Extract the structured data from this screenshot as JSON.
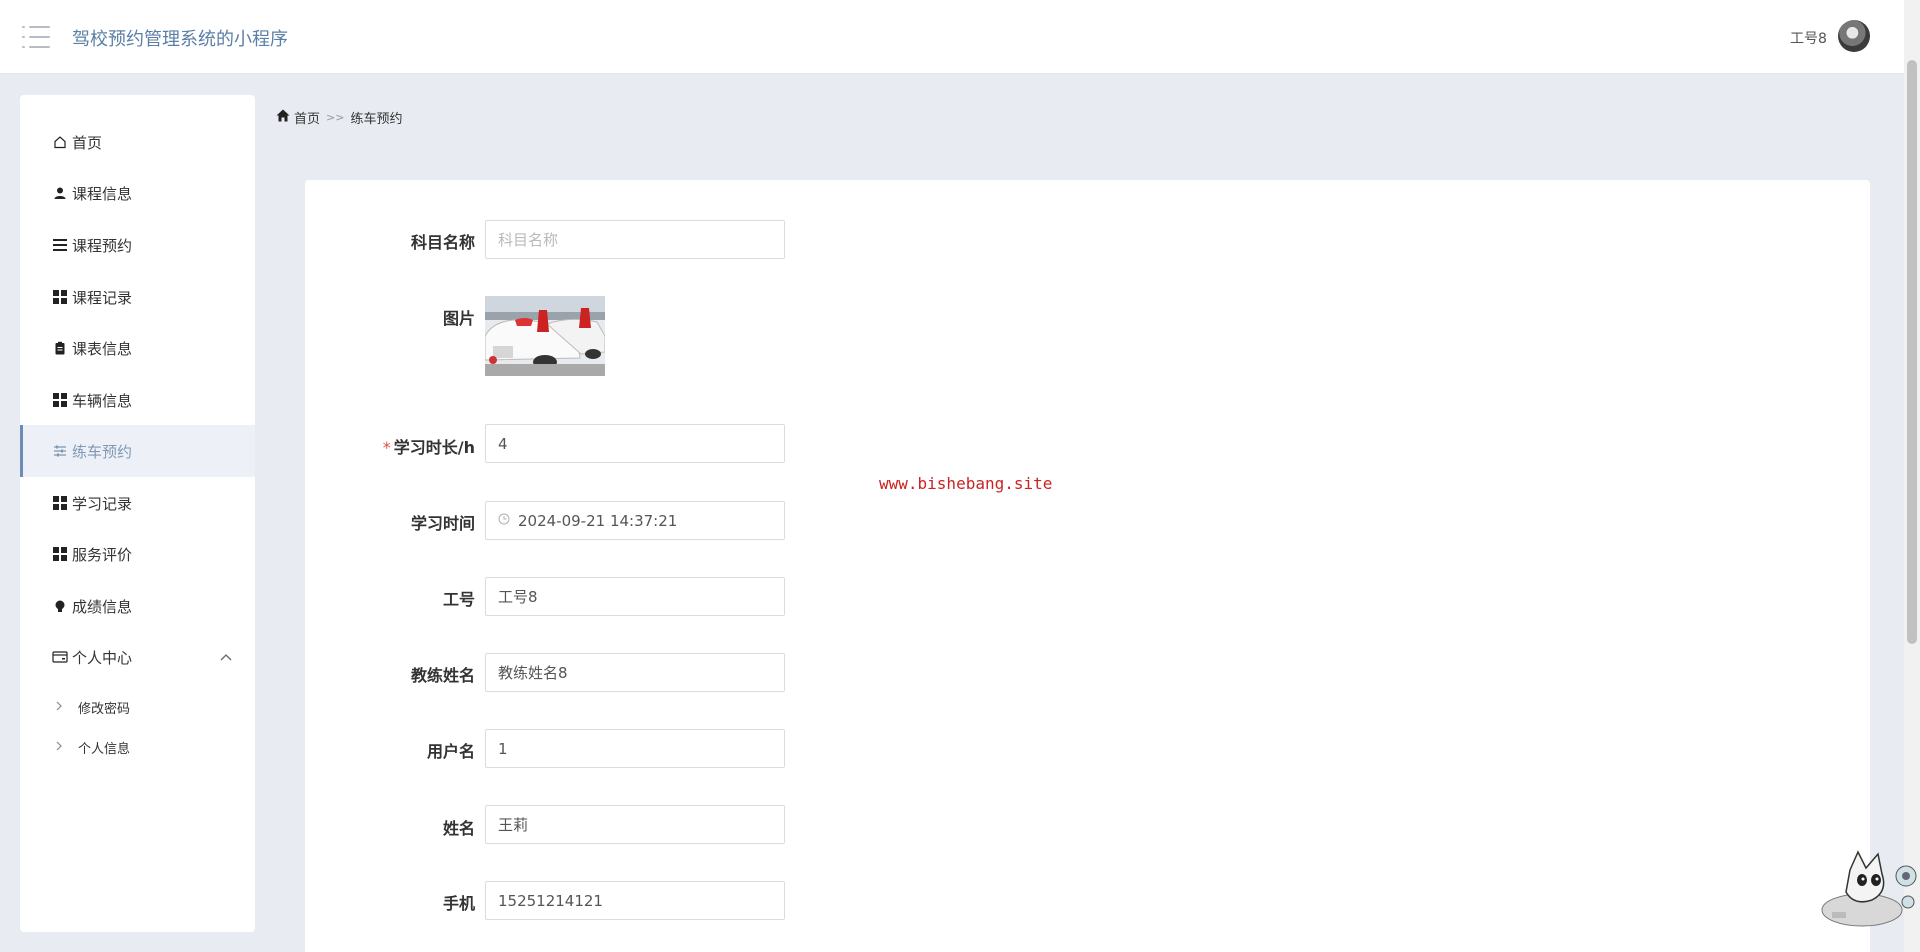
{
  "header": {
    "app_title": "驾校预约管理系统的小程序",
    "user_name": "工号8"
  },
  "sidebar": {
    "items": [
      {
        "label": "首页",
        "icon": "home-outline-icon"
      },
      {
        "label": "课程信息",
        "icon": "user-icon"
      },
      {
        "label": "课程预约",
        "icon": "list-icon"
      },
      {
        "label": "课程记录",
        "icon": "grid-icon"
      },
      {
        "label": "课表信息",
        "icon": "clipboard-icon"
      },
      {
        "label": "车辆信息",
        "icon": "grid-icon"
      },
      {
        "label": "练车预约",
        "icon": "sliders-icon",
        "active": true
      },
      {
        "label": "学习记录",
        "icon": "grid-icon"
      },
      {
        "label": "服务评价",
        "icon": "grid-icon"
      },
      {
        "label": "成绩信息",
        "icon": "bulb-icon"
      },
      {
        "label": "个人中心",
        "icon": "card-icon",
        "expanded": true
      }
    ],
    "sub_items": [
      {
        "label": "修改密码"
      },
      {
        "label": "个人信息"
      }
    ]
  },
  "breadcrumb": {
    "home": "首页",
    "separator": ">>",
    "current": "练车预约"
  },
  "form": {
    "subject": {
      "label": "科目名称",
      "placeholder": "科目名称",
      "value": ""
    },
    "image": {
      "label": "图片"
    },
    "duration": {
      "label": "学习时长/h",
      "required_mark": "*",
      "value": "4"
    },
    "study_time": {
      "label": "学习时间",
      "value": "2024-09-21 14:37:21"
    },
    "work_id": {
      "label": "工号",
      "value": "工号8"
    },
    "coach_name": {
      "label": "教练姓名",
      "value": "教练姓名8"
    },
    "username": {
      "label": "用户名",
      "value": "1"
    },
    "name": {
      "label": "姓名",
      "value": "王莉"
    },
    "phone": {
      "label": "手机",
      "value": "15251214121"
    }
  },
  "watermark": "www.bishebang.site",
  "colors": {
    "accent": "#6b8db5",
    "title": "#5b7fa6",
    "required": "#e24c4c",
    "watermark": "#cc2222",
    "background": "#e8ebf1"
  }
}
